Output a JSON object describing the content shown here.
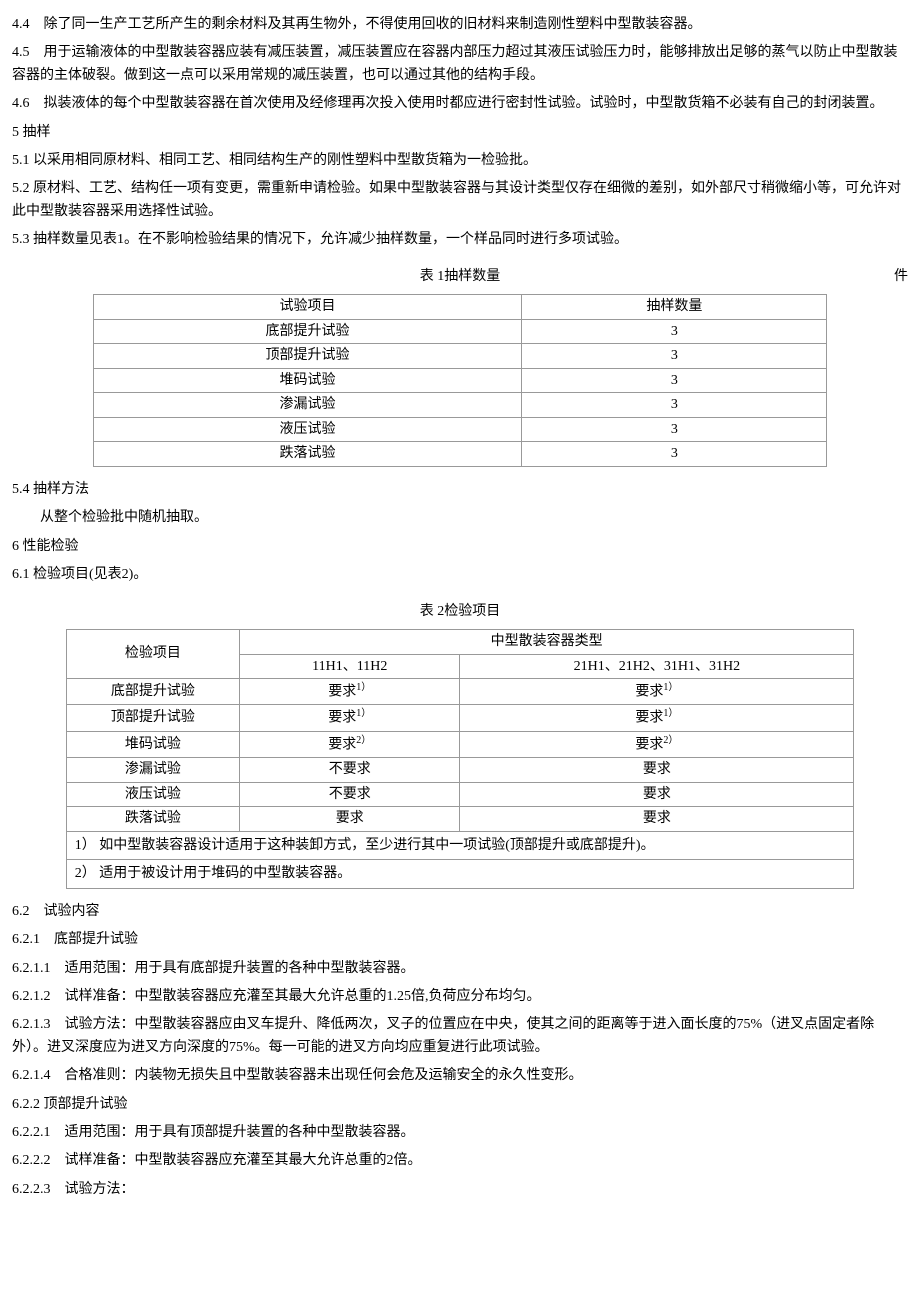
{
  "p44": "4.4　除了同一生产工艺所产生的剩余材料及其再生物外，不得使用回收的旧材料来制造刚性塑料中型散装容器。",
  "p45": "4.5　用于运输液体的中型散装容器应装有减压装置，减压装置应在容器内部压力超过其液压试验压力时，能够排放出足够的蒸气以防止中型散装容器的主体破裂。做到这一点可以采用常规的减压装置，也可以通过其他的结构手段。",
  "p46": "4.6　拟装液体的每个中型散装容器在首次使用及经修理再次投入使用时都应进行密封性试验。试验时，中型散货箱不必装有自己的封闭装置。",
  "s5": "5  抽样",
  "p51": "5.1 以采用相同原材料、相同工艺、相同结构生产的刚性塑料中型散货箱为一检验批。",
  "p52": "5.2 原材料、工艺、结构任一项有变更，需重新申请检验。如果中型散装容器与其设计类型仅存在细微的差别，如外部尺寸稍微缩小等，可允许对此中型散装容器采用选择性试验。",
  "p53": "5.3 抽样数量见表1。在不影响检验结果的情况下，允许减少抽样数量，一个样品同时进行多项试验。",
  "t1_caption": "表 1抽样数量",
  "t1_unit": "件",
  "t1_h1": "试验项目",
  "t1_h2": "抽样数量",
  "t1": [
    {
      "a": "底部提升试验",
      "b": "3"
    },
    {
      "a": "顶部提升试验",
      "b": "3"
    },
    {
      "a": "堆码试验",
      "b": "3"
    },
    {
      "a": "渗漏试验",
      "b": "3"
    },
    {
      "a": "液压试验",
      "b": "3"
    },
    {
      "a": "跌落试验",
      "b": "3"
    }
  ],
  "p54": "5.4 抽样方法",
  "p54b": "从整个检验批中随机抽取。",
  "s6": "6  性能检验",
  "p61": "6.1 检验项目(见表2)。",
  "t2_caption": "表 2检验项目",
  "t2_h1": "检验项目",
  "t2_h2": "中型散装容器类型",
  "t2_h2a": "11H1、11H2",
  "t2_h2b": "21H1、21H2、31H1、31H2",
  "req": "要求",
  "noreq": "不要求",
  "sup1": "1）",
  "sup2": "2）",
  "t2r": [
    {
      "a": "底部提升试验",
      "b": "req1",
      "c": "req1"
    },
    {
      "a": "顶部提升试验",
      "b": "req1",
      "c": "req1"
    },
    {
      "a": "堆码试验",
      "b": "req2",
      "c": "req2"
    },
    {
      "a": "渗漏试验",
      "b": "noreq",
      "c": "req"
    },
    {
      "a": "液压试验",
      "b": "noreq",
      "c": "req"
    },
    {
      "a": "跌落试验",
      "b": "req",
      "c": "req"
    }
  ],
  "t2_note1": "1） 如中型散装容器设计适用于这种装卸方式，至少进行其中一项试验(顶部提升或底部提升)。",
  "t2_note2": "2） 适用于被设计用于堆码的中型散装容器。",
  "p62": "6.2　试验内容",
  "p621": "6.2.1　底部提升试验",
  "p6211": "6.2.1.1　适用范围：用于具有底部提升装置的各种中型散装容器。",
  "p6212": "6.2.1.2　试样准备：中型散装容器应充灌至其最大允许总重的1.25倍,负荷应分布均匀。",
  "p6213": "6.2.1.3　试验方法：中型散装容器应由叉车提升、降低两次，叉子的位置应在中央，使其之间的距离等于进入面长度的75%（进叉点固定者除外）。进叉深度应为进叉方向深度的75%。每一可能的进叉方向均应重复进行此项试验。",
  "p6214": "6.2.1.4　合格准则：内装物无损失且中型散装容器未出现任何会危及运输安全的永久性变形。",
  "p622": "6.2.2 顶部提升试验",
  "p6221": "6.2.2.1　适用范围：用于具有顶部提升装置的各种中型散装容器。",
  "p6222": "6.2.2.2　试样准备：中型散装容器应充灌至其最大允许总重的2倍。",
  "p6223": "6.2.2.3　试验方法："
}
